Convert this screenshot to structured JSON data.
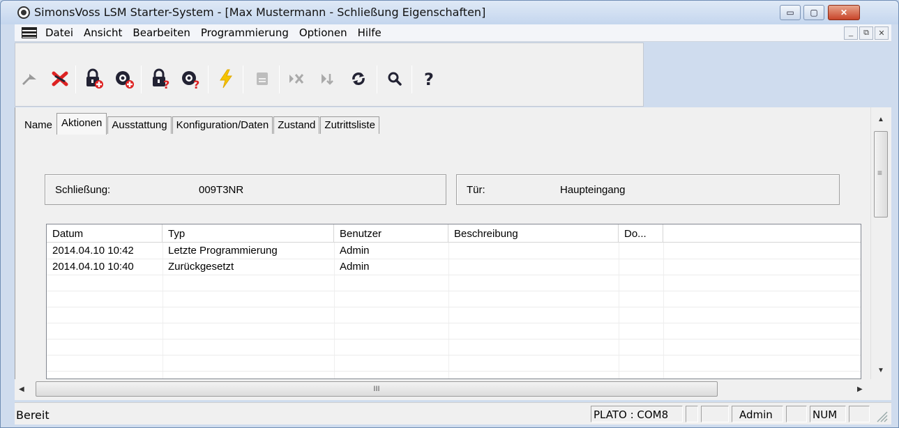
{
  "window": {
    "title": "SimonsVoss LSM Starter-System - [Max Mustermann - Schließung Eigenschaften]",
    "minimize": "▭",
    "maximize": "▢",
    "close": "✕"
  },
  "menu": {
    "items": [
      "Datei",
      "Ansicht",
      "Bearbeiten",
      "Programmierung",
      "Optionen",
      "Hilfe"
    ],
    "mdi_minimize": "_",
    "mdi_restore": "⧉",
    "mdi_close": "✕"
  },
  "toolbar": {
    "icons": [
      "import-arrow-icon",
      "delete-cross-icon",
      "add-lock-icon",
      "add-transponder-icon",
      "query-lock-icon",
      "query-transponder-icon",
      "program-lightning-icon",
      "print-icon",
      "cancel-icon",
      "next-icon",
      "sync-icon",
      "search-icon",
      "help-icon"
    ]
  },
  "tabs": [
    "Name",
    "Aktionen",
    "Ausstattung",
    "Konfiguration/Daten",
    "Zustand",
    "Zutrittsliste"
  ],
  "active_tab": "Aktionen",
  "schliessung": {
    "label": "Schließung:",
    "value": "009T3NR"
  },
  "tuer": {
    "label": "Tür:",
    "value": "Haupteingang"
  },
  "table": {
    "columns": [
      "Datum",
      "Typ",
      "Benutzer",
      "Beschreibung",
      "Do..."
    ],
    "rows": [
      [
        "2014.04.10 10:42",
        "Letzte Programmierung",
        "Admin",
        "",
        ""
      ],
      [
        "2014.04.10 10:40",
        "Zurückgesetzt",
        "Admin",
        "",
        ""
      ]
    ]
  },
  "scroll": {
    "h_grip": "III",
    "left": "◀",
    "right": "▶",
    "up": "▲",
    "down": "▼",
    "v_grip": "≡"
  },
  "status": {
    "text": "Bereit",
    "port": "PLATO : COM8",
    "user": "Admin",
    "num": "NUM"
  }
}
